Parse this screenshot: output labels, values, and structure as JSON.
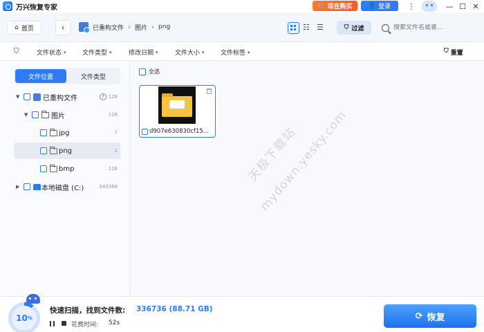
{
  "titlebar": {
    "title": "万兴恢复专家",
    "buy_label": "现在购买",
    "login_label": "登录",
    "menu_icon": "⋮",
    "min_icon": "—",
    "max_icon": "☐",
    "close_icon": "✕"
  },
  "nav": {
    "home_label": "首页",
    "crumbs": [
      "已重构文件",
      "图片",
      "png"
    ],
    "filter_label": "过滤",
    "search_placeholder": "搜索文件名或者..."
  },
  "filters": {
    "items": [
      "文件状态",
      "文件类型",
      "修改日期",
      "文件大小",
      "文件标签"
    ],
    "reset_label": "重置"
  },
  "sidebar": {
    "tab_location": "文件位置",
    "tab_type": "文件类型",
    "tree": [
      {
        "label": "已重构文件",
        "count": "126"
      },
      {
        "label": "图片",
        "count": "126"
      },
      {
        "label": "jpg",
        "count": "7"
      },
      {
        "label": "png",
        "count": "1"
      },
      {
        "label": "bmp",
        "count": "118"
      },
      {
        "label": "本地磁盘 (C:)",
        "count": "340366"
      }
    ]
  },
  "main": {
    "select_all": "全选",
    "files": [
      {
        "name": "d907e630830cf15..."
      }
    ]
  },
  "watermark": {
    "line1": "天极下载站",
    "line2": "mydown.yesky.com"
  },
  "bottom": {
    "progress_percent": 10,
    "progress_num": "10",
    "progress_unit": "%",
    "scan_label": "快速扫描，找到文件数:",
    "scan_count": "336736 (88.71 GB)",
    "time_label": "花费时间:",
    "time_value": "52s",
    "recover_label": "恢复"
  },
  "colors": {
    "accent": "#2f7bf5",
    "buy": "#ff6a2f"
  }
}
